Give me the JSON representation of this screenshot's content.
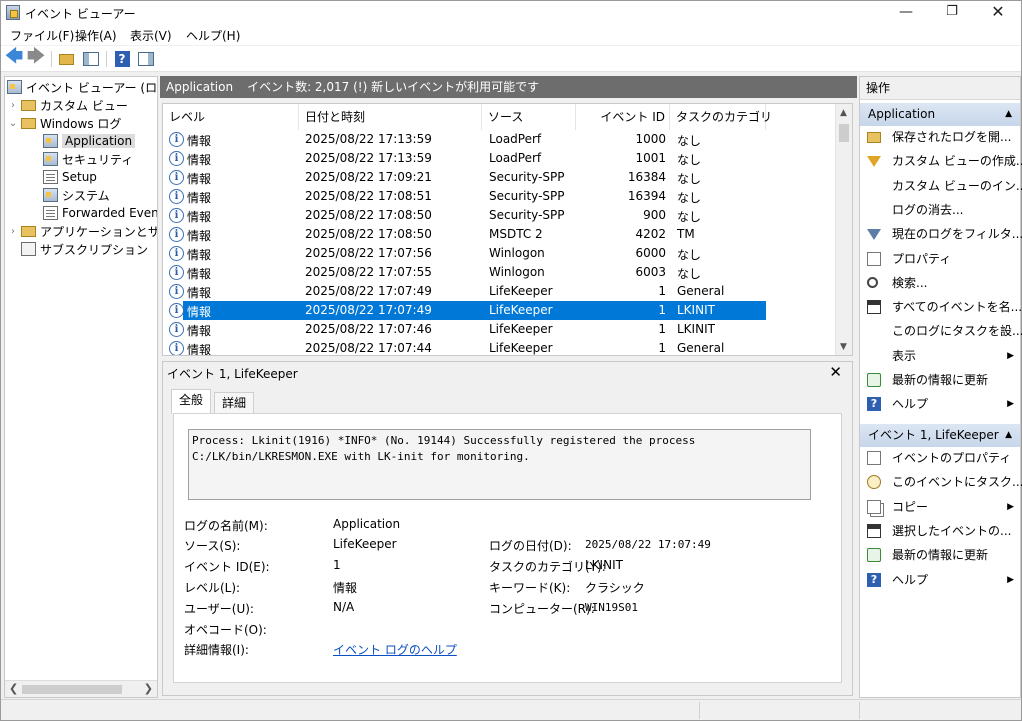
{
  "window": {
    "title": "イベント ビューアー",
    "min": "—",
    "max": "❐",
    "close": "✕"
  },
  "menu": [
    "ファイル(F)",
    "操作(A)",
    "表示(V)",
    "ヘルプ(H)"
  ],
  "toolbar": {
    "back": "🡄",
    "forward": "🡆",
    "help": "?"
  },
  "tree": {
    "root": "イベント ビューアー (ローカル)",
    "custom_views": "カスタム ビュー",
    "windows_logs": "Windows ログ",
    "logs": [
      "Application",
      "セキュリティ",
      "Setup",
      "システム",
      "Forwarded Events"
    ],
    "apps_services": "アプリケーションとサービス",
    "subscriptions": "サブスクリプション",
    "twisty_closed": "›",
    "twisty_open": "⌄"
  },
  "center": {
    "log_name": "Application",
    "summary": "イベント数: 2,017 (!) 新しいイベントが利用可能です"
  },
  "columns": [
    "レベル",
    "日付と時刻",
    "ソース",
    "イベント ID",
    "タスクのカテゴリ"
  ],
  "events": [
    {
      "level": "情報",
      "datetime": "2025/08/22 17:13:59",
      "source": "LoadPerf",
      "id": "1000",
      "category": "なし"
    },
    {
      "level": "情報",
      "datetime": "2025/08/22 17:13:59",
      "source": "LoadPerf",
      "id": "1001",
      "category": "なし"
    },
    {
      "level": "情報",
      "datetime": "2025/08/22 17:09:21",
      "source": "Security-SPP",
      "id": "16384",
      "category": "なし"
    },
    {
      "level": "情報",
      "datetime": "2025/08/22 17:08:51",
      "source": "Security-SPP",
      "id": "16394",
      "category": "なし"
    },
    {
      "level": "情報",
      "datetime": "2025/08/22 17:08:50",
      "source": "Security-SPP",
      "id": "900",
      "category": "なし"
    },
    {
      "level": "情報",
      "datetime": "2025/08/22 17:08:50",
      "source": "MSDTC 2",
      "id": "4202",
      "category": "TM"
    },
    {
      "level": "情報",
      "datetime": "2025/08/22 17:07:56",
      "source": "Winlogon",
      "id": "6000",
      "category": "なし"
    },
    {
      "level": "情報",
      "datetime": "2025/08/22 17:07:55",
      "source": "Winlogon",
      "id": "6003",
      "category": "なし"
    },
    {
      "level": "情報",
      "datetime": "2025/08/22 17:07:49",
      "source": "LifeKeeper",
      "id": "1",
      "category": "General"
    },
    {
      "level": "情報",
      "datetime": "2025/08/22 17:07:49",
      "source": "LifeKeeper",
      "id": "1",
      "category": "LKINIT",
      "selected": true
    },
    {
      "level": "情報",
      "datetime": "2025/08/22 17:07:46",
      "source": "LifeKeeper",
      "id": "1",
      "category": "LKINIT"
    },
    {
      "level": "情報",
      "datetime": "2025/08/22 17:07:44",
      "source": "LifeKeeper",
      "id": "1",
      "category": "General"
    }
  ],
  "detail": {
    "title": "イベント 1, LifeKeeper",
    "close": "✕",
    "tabs": [
      "全般",
      "詳細"
    ],
    "message": "Process: Lkinit(1916)  *INFO* (No. 19144) Successfully registered the process C:/LK/bin/LKRESMON.EXE with LK-init for monitoring.",
    "labels": {
      "log_name": "ログの名前(M):",
      "source": "ソース(S):",
      "event_id": "イベント ID(E):",
      "level": "レベル(L):",
      "user": "ユーザー(U):",
      "opcode": "オペコード(O):",
      "more_info": "詳細情報(I):",
      "logged": "ログの日付(D):",
      "task_category": "タスクのカテゴリ(Y):",
      "keywords": "キーワード(K):",
      "computer": "コンピューター(R):"
    },
    "values": {
      "log_name": "Application",
      "source": "LifeKeeper",
      "event_id": "1",
      "level": "情報",
      "user": "N/A",
      "opcode": "",
      "more_info": "イベント ログのヘルプ",
      "logged": "2025/08/22 17:07:49",
      "task_category": "LKINIT",
      "keywords": "クラシック",
      "computer": "WIN19S01"
    }
  },
  "actions": {
    "header": "操作",
    "section1": "Application",
    "items1": [
      {
        "label": "保存されたログを開...",
        "icon": "folder-icon"
      },
      {
        "label": "カスタム ビューの作成...",
        "icon": "filter-icon"
      },
      {
        "label": "カスタム ビューのイン...",
        "icon": ""
      },
      {
        "label": "ログの消去...",
        "icon": ""
      },
      {
        "label": "現在のログをフィルタ...",
        "icon": "filter-icon"
      },
      {
        "label": "プロパティ",
        "icon": "properties-icon"
      },
      {
        "label": "検索...",
        "icon": "find-icon"
      },
      {
        "label": "すべてのイベントを名...",
        "icon": "save-icon"
      },
      {
        "label": "このログにタスクを設...",
        "icon": ""
      },
      {
        "label": "表示",
        "icon": "",
        "submenu": true
      },
      {
        "label": "最新の情報に更新",
        "icon": "refresh-icon"
      },
      {
        "label": "ヘルプ",
        "icon": "help-icon",
        "submenu": true
      }
    ],
    "section2": "イベント 1, LifeKeeper",
    "items2": [
      {
        "label": "イベントのプロパティ",
        "icon": "properties-icon"
      },
      {
        "label": "このイベントにタスク...",
        "icon": "task-icon"
      },
      {
        "label": "コピー",
        "icon": "copy-icon",
        "submenu": true
      },
      {
        "label": "選択したイベントの...",
        "icon": "save-icon"
      },
      {
        "label": "最新の情報に更新",
        "icon": "refresh-icon"
      },
      {
        "label": "ヘルプ",
        "icon": "help-icon",
        "submenu": true
      }
    ],
    "submenu_arrow": "▶",
    "collapse_caret": "▲"
  },
  "colors": {
    "selection": "#0078d7",
    "header_bar": "#6d6d6d",
    "section_header": "#c7d6ea"
  }
}
